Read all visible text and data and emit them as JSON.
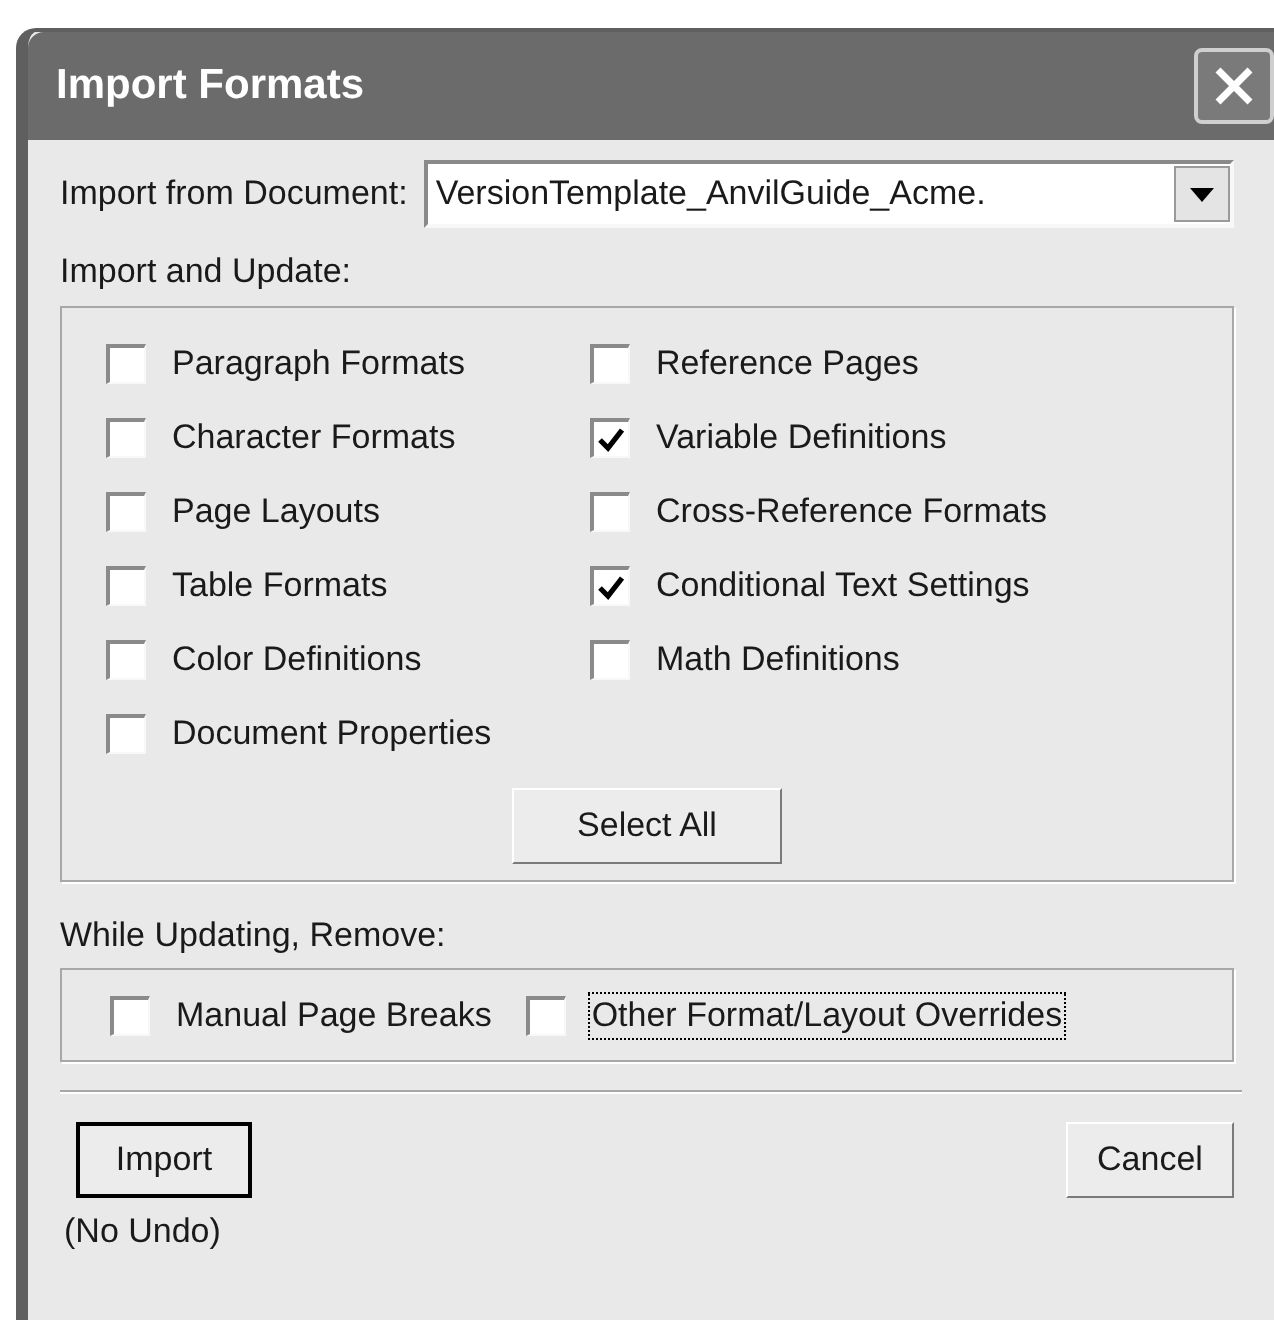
{
  "window": {
    "title": "Import Formats"
  },
  "source": {
    "label": "Import from Document:",
    "value": "VersionTemplate_AnvilGuide_Acme."
  },
  "import_update": {
    "label": "Import and Update:",
    "columns": [
      [
        {
          "label": "Paragraph Formats",
          "checked": false
        },
        {
          "label": "Character Formats",
          "checked": false
        },
        {
          "label": "Page Layouts",
          "checked": false
        },
        {
          "label": "Table Formats",
          "checked": false
        },
        {
          "label": "Color Definitions",
          "checked": false
        },
        {
          "label": "Document Properties",
          "checked": false
        }
      ],
      [
        {
          "label": "Reference Pages",
          "checked": false
        },
        {
          "label": "Variable Definitions",
          "checked": true
        },
        {
          "label": "Cross-Reference Formats",
          "checked": false
        },
        {
          "label": "Conditional Text Settings",
          "checked": true
        },
        {
          "label": "Math Definitions",
          "checked": false
        }
      ]
    ],
    "select_all": "Select All"
  },
  "remove": {
    "label": "While Updating, Remove:",
    "items": [
      {
        "label": "Manual Page Breaks",
        "checked": false,
        "focused": false
      },
      {
        "label": "Other Format/Layout Overrides",
        "checked": false,
        "focused": true
      }
    ]
  },
  "buttons": [
    {
      "label": "Import",
      "default": true
    },
    {
      "label": "Cancel",
      "default": false
    }
  ],
  "note": "(No Undo)"
}
